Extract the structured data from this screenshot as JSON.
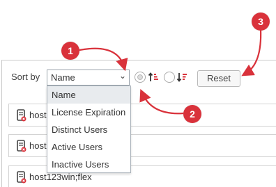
{
  "toolbar": {
    "sort_label": "Sort by",
    "sort_selected": "Name",
    "reset_label": "Reset"
  },
  "dropdown": {
    "options": [
      "Name",
      "License Expiration",
      "Distinct Users",
      "Active Users",
      "Inactive Users"
    ],
    "selected_index": 0
  },
  "rows": [
    {
      "label": "host"
    },
    {
      "label": "host"
    },
    {
      "label": "host123win;flex"
    }
  ],
  "callouts": [
    "1",
    "2",
    "3"
  ],
  "icons": {
    "sort_ascending": "sort-ascending-icon",
    "sort_descending": "sort-descending-icon",
    "server": "server-error-icon"
  },
  "colors": {
    "accent_red": "#d9323b",
    "border": "#c9c9c9"
  }
}
